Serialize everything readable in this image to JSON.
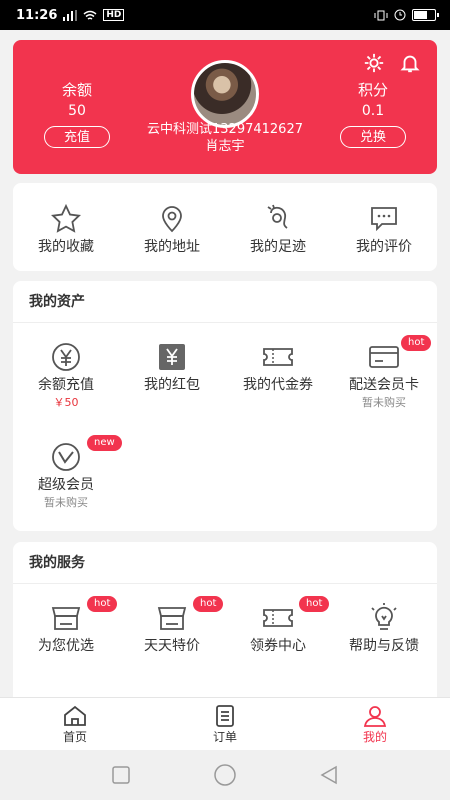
{
  "status_bar": {
    "time": "11:26",
    "signal_text": "HD"
  },
  "header": {
    "balance_label": "余额",
    "balance_value": "50",
    "recharge_button": "充值",
    "points_label": "积分",
    "points_value": "0.1",
    "exchange_button": "兑换",
    "user_line1": "云中科测试13297412627",
    "user_line2": "肖志宇",
    "colors": {
      "accent": "#f2344e"
    }
  },
  "quick": [
    {
      "label": "我的收藏",
      "icon": "star-icon"
    },
    {
      "label": "我的地址",
      "icon": "location-icon"
    },
    {
      "label": "我的足迹",
      "icon": "footprint-icon"
    },
    {
      "label": "我的评价",
      "icon": "comment-icon"
    }
  ],
  "assets": {
    "title": "我的资产",
    "items": [
      {
        "label": "余额充值",
        "sub": "￥50",
        "icon": "yen-coin-icon"
      },
      {
        "label": "我的红包",
        "sub": "",
        "icon": "red-packet-icon"
      },
      {
        "label": "我的代金券",
        "sub": "",
        "icon": "voucher-icon"
      },
      {
        "label": "配送会员卡",
        "sub": "暂未购买",
        "badge": "hot",
        "icon": "card-icon"
      },
      {
        "label": "超级会员",
        "sub": "暂未购买",
        "badge": "new",
        "icon": "vip-icon"
      }
    ]
  },
  "services": {
    "title": "我的服务",
    "items": [
      {
        "label": "为您优选",
        "badge": "hot",
        "icon": "shop-icon"
      },
      {
        "label": "天天特价",
        "badge": "hot",
        "icon": "shop-icon"
      },
      {
        "label": "领券中心",
        "badge": "hot",
        "icon": "ticket-icon"
      },
      {
        "label": "帮助与反馈",
        "icon": "bulb-icon"
      }
    ]
  },
  "bottom_nav": [
    {
      "label": "首页",
      "icon": "home-icon"
    },
    {
      "label": "订单",
      "icon": "order-icon"
    },
    {
      "label": "我的",
      "icon": "user-icon",
      "active": true
    }
  ]
}
